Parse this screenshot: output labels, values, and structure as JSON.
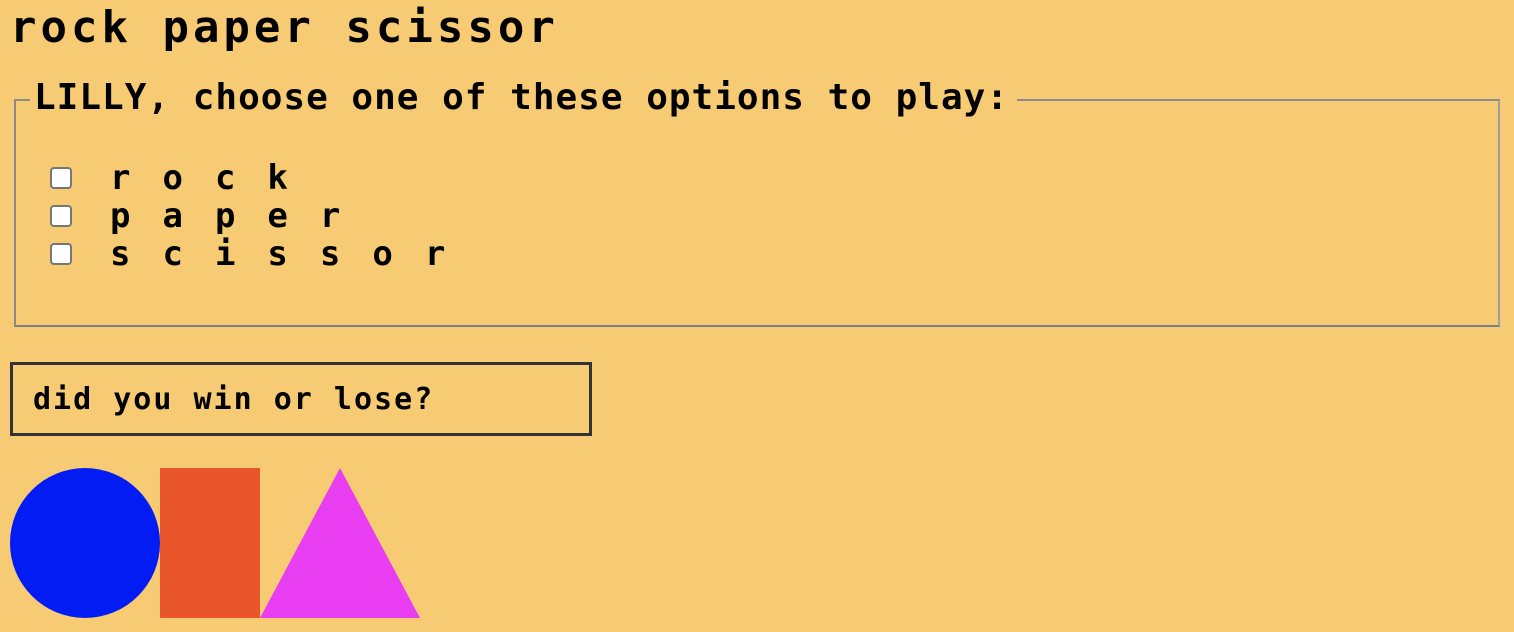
{
  "page": {
    "title": "rock paper scissor"
  },
  "form": {
    "legend": "LILLY, choose one of these options to play:",
    "options": [
      {
        "label": "rock",
        "checked": false
      },
      {
        "label": "paper",
        "checked": false
      },
      {
        "label": "scissor",
        "checked": false
      }
    ]
  },
  "result_button": {
    "label": "did you win or lose?"
  },
  "shapes": {
    "circle_color": "#021cf3",
    "rectangle_color": "#e9562b",
    "triangle_color": "#e83df1"
  },
  "colors": {
    "background": "#f6cb74"
  }
}
